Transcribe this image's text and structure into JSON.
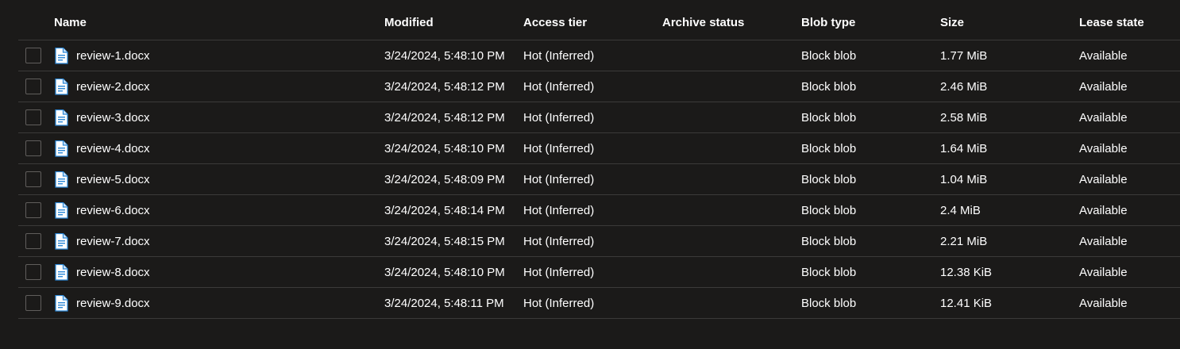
{
  "columns": {
    "name": "Name",
    "modified": "Modified",
    "access_tier": "Access tier",
    "archive_status": "Archive status",
    "blob_type": "Blob type",
    "size": "Size",
    "lease_state": "Lease state"
  },
  "icons": {
    "file": "docx-file-icon",
    "accent": "#2b88d8"
  },
  "rows": [
    {
      "name": "review-1.docx",
      "modified": "3/24/2024, 5:48:10 PM",
      "access_tier": "Hot (Inferred)",
      "archive_status": "",
      "blob_type": "Block blob",
      "size": "1.77 MiB",
      "lease_state": "Available"
    },
    {
      "name": "review-2.docx",
      "modified": "3/24/2024, 5:48:12 PM",
      "access_tier": "Hot (Inferred)",
      "archive_status": "",
      "blob_type": "Block blob",
      "size": "2.46 MiB",
      "lease_state": "Available"
    },
    {
      "name": "review-3.docx",
      "modified": "3/24/2024, 5:48:12 PM",
      "access_tier": "Hot (Inferred)",
      "archive_status": "",
      "blob_type": "Block blob",
      "size": "2.58 MiB",
      "lease_state": "Available"
    },
    {
      "name": "review-4.docx",
      "modified": "3/24/2024, 5:48:10 PM",
      "access_tier": "Hot (Inferred)",
      "archive_status": "",
      "blob_type": "Block blob",
      "size": "1.64 MiB",
      "lease_state": "Available"
    },
    {
      "name": "review-5.docx",
      "modified": "3/24/2024, 5:48:09 PM",
      "access_tier": "Hot (Inferred)",
      "archive_status": "",
      "blob_type": "Block blob",
      "size": "1.04 MiB",
      "lease_state": "Available"
    },
    {
      "name": "review-6.docx",
      "modified": "3/24/2024, 5:48:14 PM",
      "access_tier": "Hot (Inferred)",
      "archive_status": "",
      "blob_type": "Block blob",
      "size": "2.4 MiB",
      "lease_state": "Available"
    },
    {
      "name": "review-7.docx",
      "modified": "3/24/2024, 5:48:15 PM",
      "access_tier": "Hot (Inferred)",
      "archive_status": "",
      "blob_type": "Block blob",
      "size": "2.21 MiB",
      "lease_state": "Available"
    },
    {
      "name": "review-8.docx",
      "modified": "3/24/2024, 5:48:10 PM",
      "access_tier": "Hot (Inferred)",
      "archive_status": "",
      "blob_type": "Block blob",
      "size": "12.38 KiB",
      "lease_state": "Available"
    },
    {
      "name": "review-9.docx",
      "modified": "3/24/2024, 5:48:11 PM",
      "access_tier": "Hot (Inferred)",
      "archive_status": "",
      "blob_type": "Block blob",
      "size": "12.41 KiB",
      "lease_state": "Available"
    }
  ]
}
